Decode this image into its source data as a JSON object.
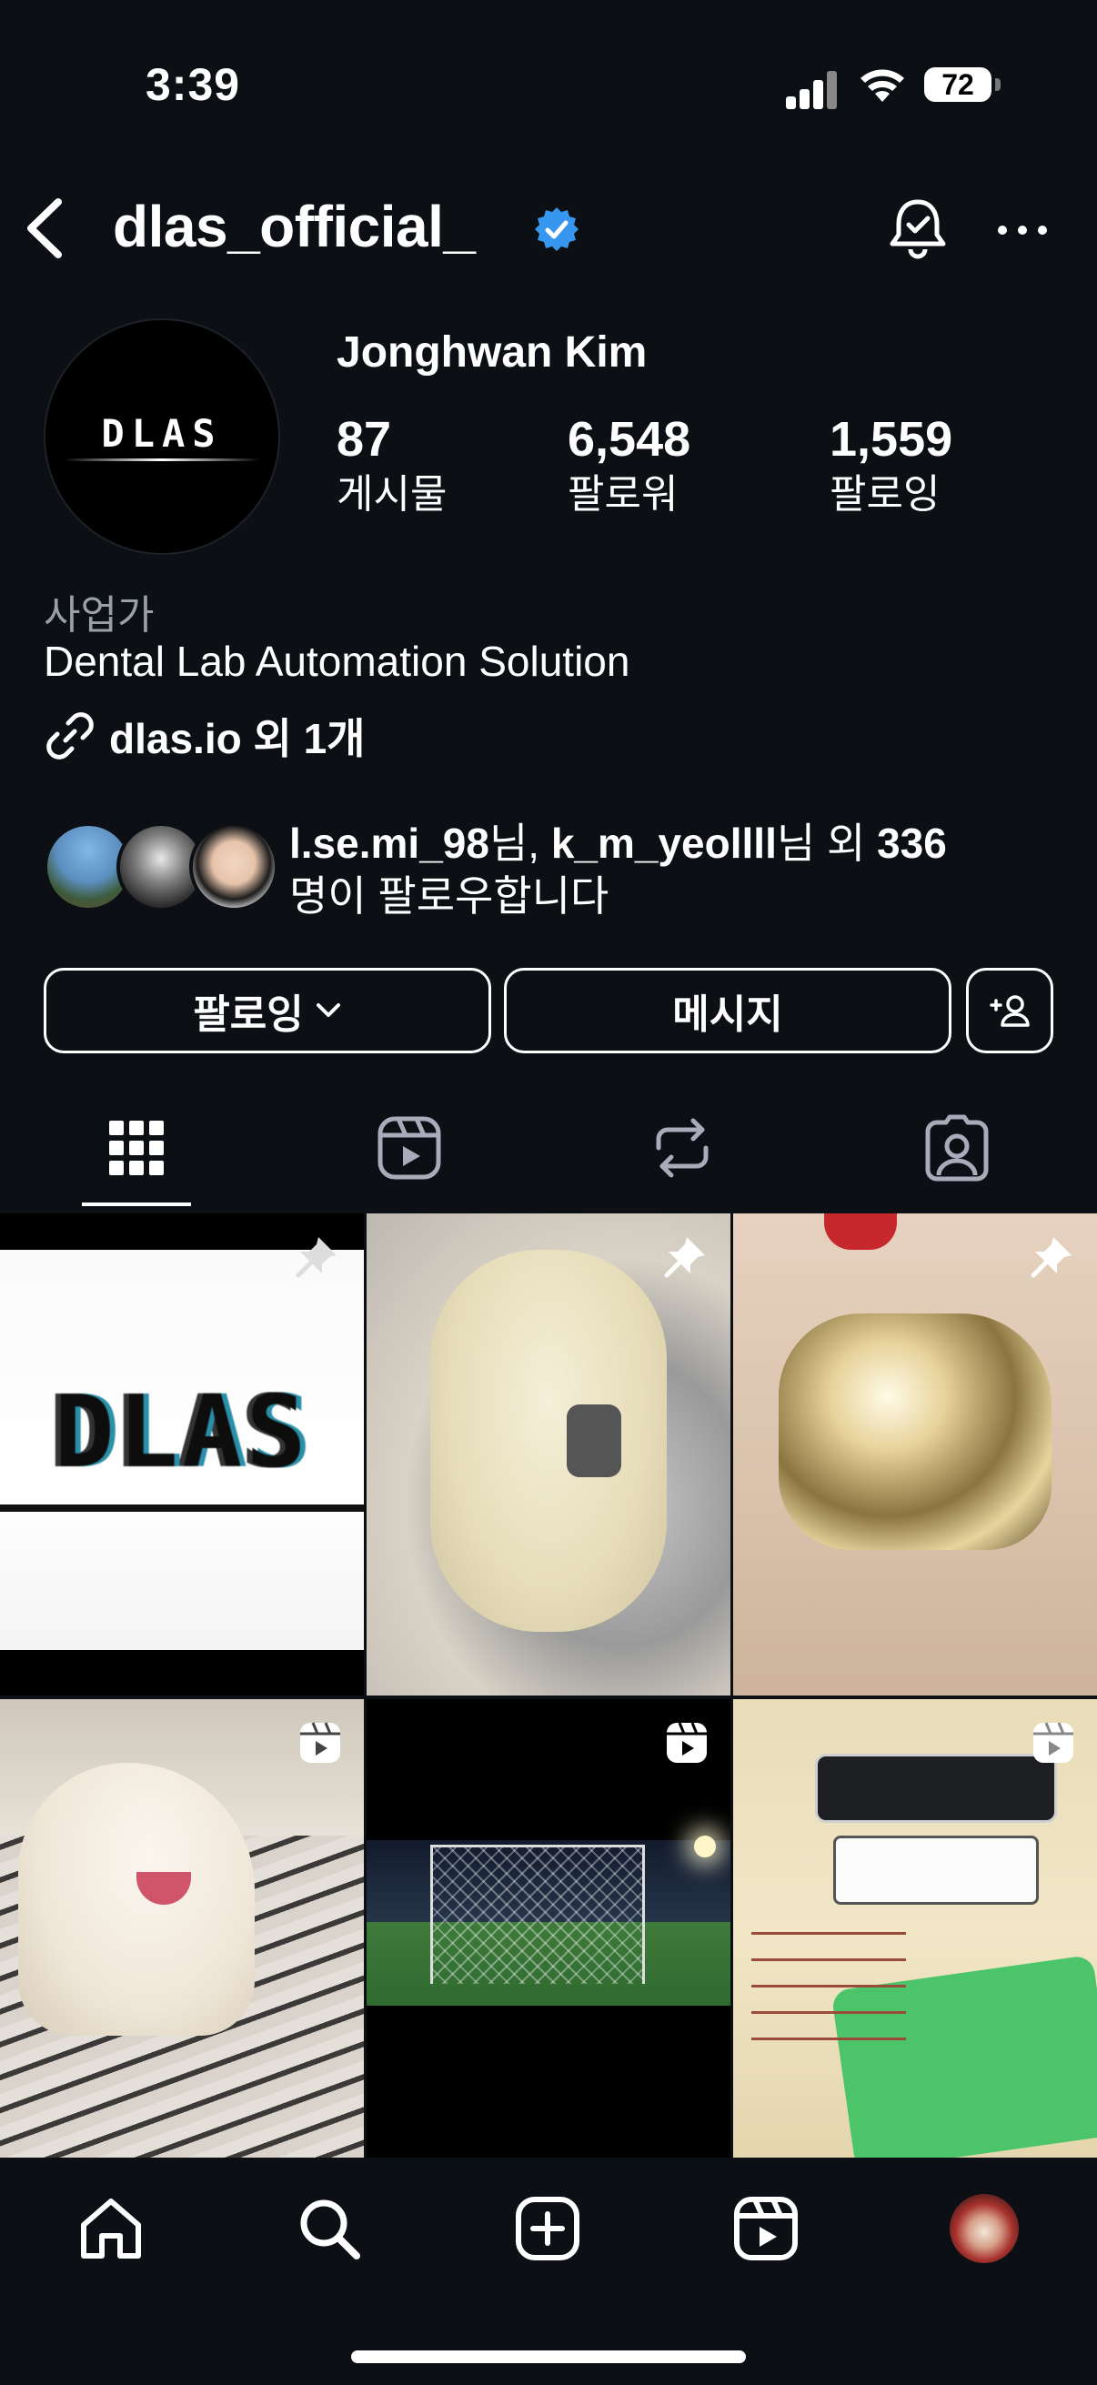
{
  "status_bar": {
    "time": "3:39",
    "battery": "72"
  },
  "header": {
    "username": "dlas_official_"
  },
  "profile": {
    "full_name": "Jonghwan  Kim",
    "avatar_logo": "DLAS",
    "stats": [
      {
        "number": "87",
        "label": "게시물"
      },
      {
        "number": "6,548",
        "label": "팔로워"
      },
      {
        "number": "1,559",
        "label": "팔로잉"
      }
    ],
    "category": "사업가",
    "bio": "Dental Lab Automation Solution",
    "link": "dlas.io 외 1개",
    "followed_by": {
      "user1": "l.se.mi_98",
      "suffix1": "님, ",
      "user2": "k_m_yeollll",
      "suffix2": "님 외 ",
      "count": "336",
      "line2": "명이 팔로우합니다"
    }
  },
  "actions": {
    "follow": "팔로잉",
    "message": "메시지"
  },
  "tabs": [
    "grid-icon",
    "reels-icon",
    "reposts-icon",
    "tagged-icon"
  ],
  "grid": {
    "tile1_text": "DLAS"
  },
  "colors": {
    "background": "#0c0f14",
    "verified": "#3797f0",
    "text": "#ffffff",
    "muted": "#9aa0a8"
  },
  "bottom_nav": [
    "home-icon",
    "search-icon",
    "create-icon",
    "reels-icon",
    "profile-avatar"
  ]
}
